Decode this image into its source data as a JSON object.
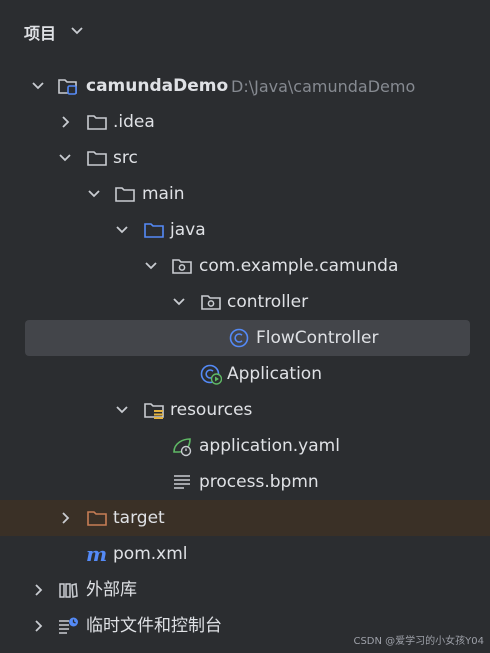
{
  "header": {
    "title": "项目"
  },
  "tree": {
    "root": {
      "name": "camundaDemo",
      "path": "D:\\Java\\camundaDemo"
    },
    "idea": ".idea",
    "src": "src",
    "main": "main",
    "java": "java",
    "package": "com.example.camunda",
    "controller": "controller",
    "flow_controller": "FlowController",
    "application": "Application",
    "resources": "resources",
    "application_yaml": "application.yaml",
    "process_bpmn": "process.bpmn",
    "target": "target",
    "pom": "pom.xml",
    "external_libs": "外部库",
    "scratches": "临时文件和控制台"
  },
  "watermark": "CSDN @爱学习的小女孩Y04",
  "colors": {
    "background": "#2b2d30",
    "selected": "#43454a",
    "target_row": "#3a3026",
    "java_folder": "#548af7",
    "target_folder": "#c77d55",
    "spring_green": "#5fb865"
  }
}
